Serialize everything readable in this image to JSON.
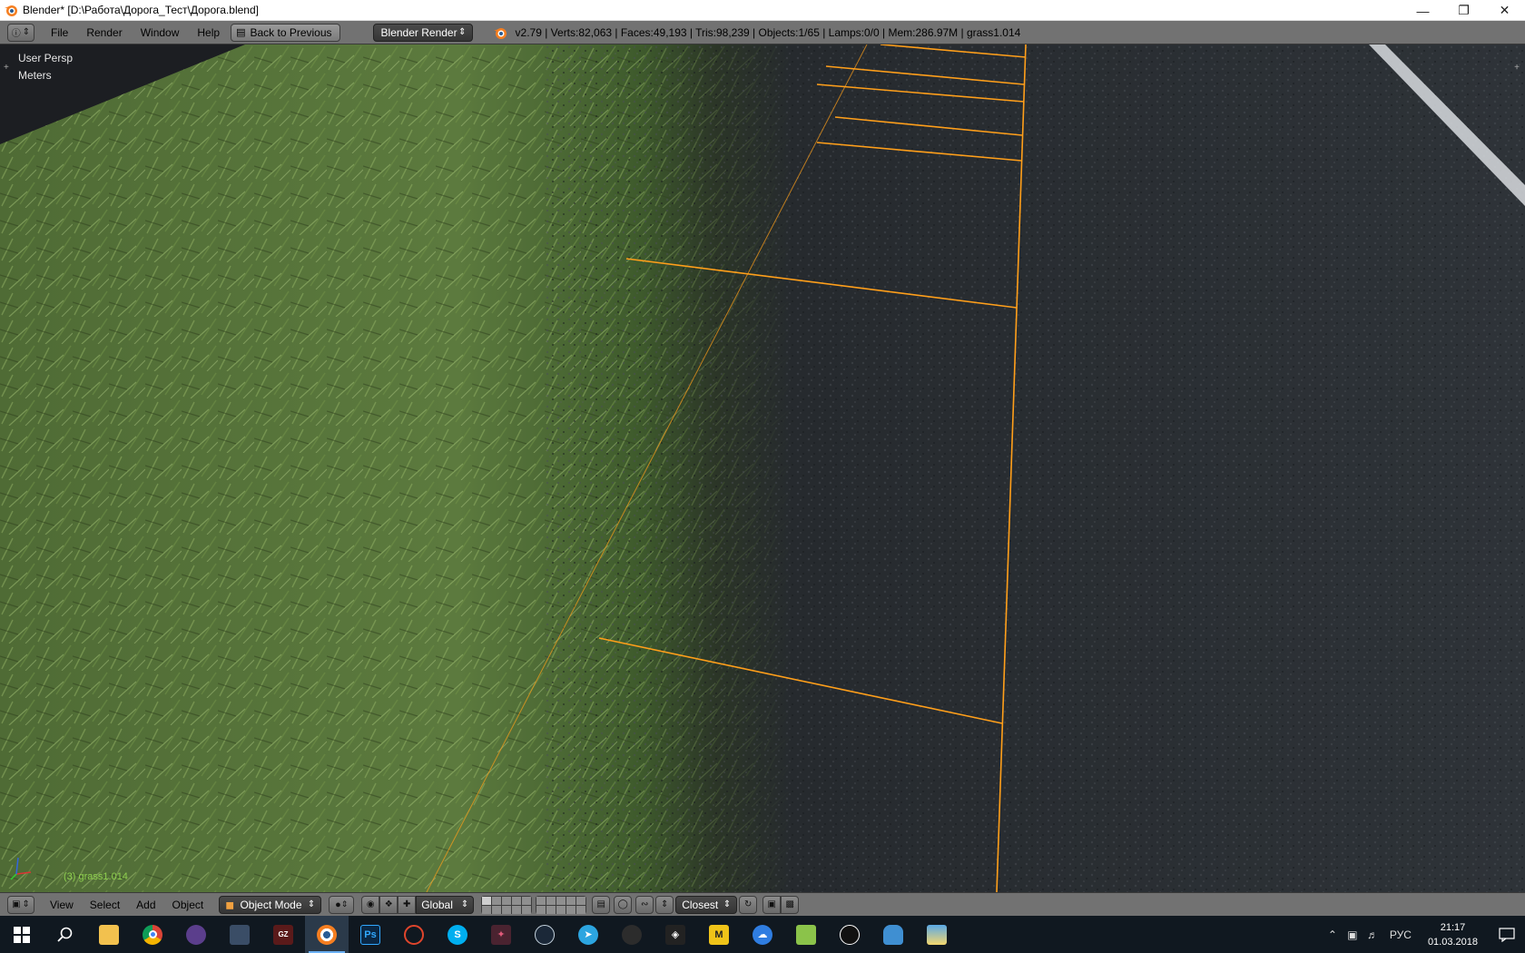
{
  "window": {
    "title": "Blender* [D:\\Работа\\Дорога_Тест\\Дорога.blend]",
    "controls": [
      "minimize",
      "restore",
      "close"
    ]
  },
  "info_header": {
    "menus": [
      "File",
      "Render",
      "Window",
      "Help"
    ],
    "back_button": "Back to Previous",
    "render_engine": "Blender Render",
    "stats": "v2.79 | Verts:82,063 | Faces:49,193 | Tris:98,239 | Objects:1/65 | Lamps:0/0 | Mem:286.97M | grass1.014"
  },
  "viewport": {
    "view_name": "User Persp",
    "units": "Meters",
    "object_label": "(3) grass1.014",
    "wire_color": "#ff9f1a",
    "selected_text_color": "#8fd14f"
  },
  "view_header": {
    "menus": [
      "View",
      "Select",
      "Add",
      "Object"
    ],
    "mode": "Object Mode",
    "orientation": "Global",
    "snap_element": "Closest"
  },
  "taskbar": {
    "apps": [
      {
        "name": "windows-start-icon"
      },
      {
        "name": "search-icon"
      },
      {
        "name": "file-explorer-icon"
      },
      {
        "name": "chrome-icon"
      },
      {
        "name": "app-icon-1"
      },
      {
        "name": "app-icon-2"
      },
      {
        "name": "gzdoom-icon"
      },
      {
        "name": "blender-icon",
        "active": true
      },
      {
        "name": "photoshop-icon",
        "label": "Ps"
      },
      {
        "name": "app-icon-3"
      },
      {
        "name": "skype-icon",
        "label": "S"
      },
      {
        "name": "app-icon-4"
      },
      {
        "name": "steam-icon"
      },
      {
        "name": "telegram-icon"
      },
      {
        "name": "app-icon-5"
      },
      {
        "name": "unity-icon"
      },
      {
        "name": "app-icon-m",
        "label": "M"
      },
      {
        "name": "cloud-icon"
      },
      {
        "name": "notepad-icon"
      },
      {
        "name": "app-icon-6"
      },
      {
        "name": "app-icon-7"
      },
      {
        "name": "image-viewer-icon"
      }
    ],
    "language": "РУС",
    "time": "21:17",
    "date": "01.03.2018"
  }
}
